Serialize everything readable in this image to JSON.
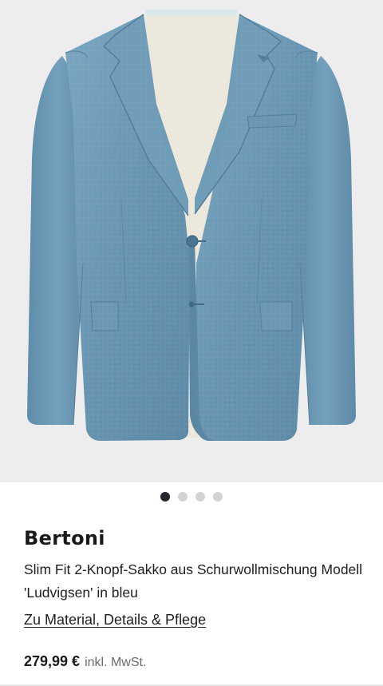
{
  "gallery": {
    "image_name": "blue-blazer-product-photo",
    "slide_count": 4,
    "active_slide": 1,
    "background": "#ededed",
    "jacket_color": "#6b98b3"
  },
  "product": {
    "brand": "Bertoni",
    "title": "Slim Fit 2-Knopf-Sakko aus Schurwollmischung Modell 'Ludvigsen' in bleu",
    "details_link": "Zu Material, Details & Pflege",
    "price": "279,99 €",
    "tax_note": "inkl. MwSt."
  }
}
